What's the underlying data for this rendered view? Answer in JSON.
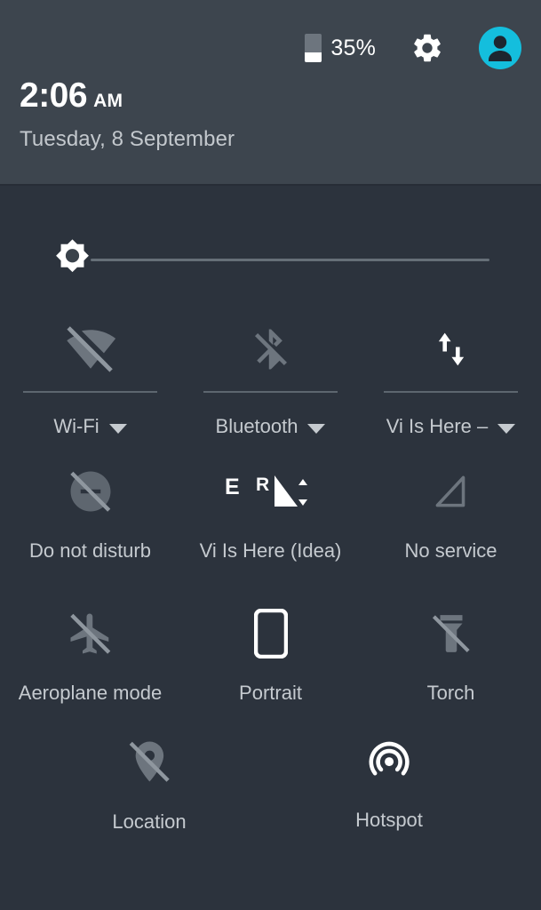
{
  "statusbar": {
    "battery_percent_label": "35%",
    "battery_level": 35,
    "battery_icon": "battery-icon",
    "settings_icon": "gear-icon",
    "avatar_icon": "user-avatar-icon",
    "accent_color": "#14bedd"
  },
  "clock": {
    "time": "2:06",
    "ampm": "AM",
    "date": "Tuesday, 8 September"
  },
  "brightness": {
    "icon": "brightness-sun-icon",
    "value": 0,
    "label": "Brightness"
  },
  "tiles": {
    "row1": [
      {
        "label": "Wi-Fi",
        "icon": "wifi-off-icon",
        "state": "off",
        "has_caret": true
      },
      {
        "label": "Bluetooth",
        "icon": "bluetooth-off-icon",
        "state": "off",
        "has_caret": true
      },
      {
        "label": "Vi Is Here – ",
        "icon": "data-transfer-icon",
        "state": "on",
        "has_caret": true
      }
    ],
    "row2": [
      {
        "label": "Do not disturb",
        "icon": "do-not-disturb-off-icon",
        "state": "off"
      },
      {
        "label": "Vi Is Here (Idea)",
        "icon": "mobile-signal-icon",
        "state": "on",
        "network_type": "E",
        "roaming": "R"
      },
      {
        "label": "No service",
        "icon": "no-signal-icon",
        "state": "off"
      }
    ],
    "row3": [
      {
        "label": "Aeroplane mode",
        "icon": "airplane-off-icon",
        "state": "off"
      },
      {
        "label": "Portrait",
        "icon": "screen-rotation-portrait-icon",
        "state": "on"
      },
      {
        "label": "Torch",
        "icon": "flashlight-off-icon",
        "state": "off"
      }
    ],
    "row4": [
      {
        "label": "Location",
        "icon": "location-off-icon",
        "state": "off"
      },
      {
        "label": "Hotspot",
        "icon": "hotspot-icon",
        "state": "on"
      }
    ]
  },
  "colors": {
    "header_bg": "#3d454e",
    "panel_bg": "#2c333d",
    "icon_on": "#ffffff",
    "icon_off": "#6d757e",
    "label": "#c5cacf"
  }
}
